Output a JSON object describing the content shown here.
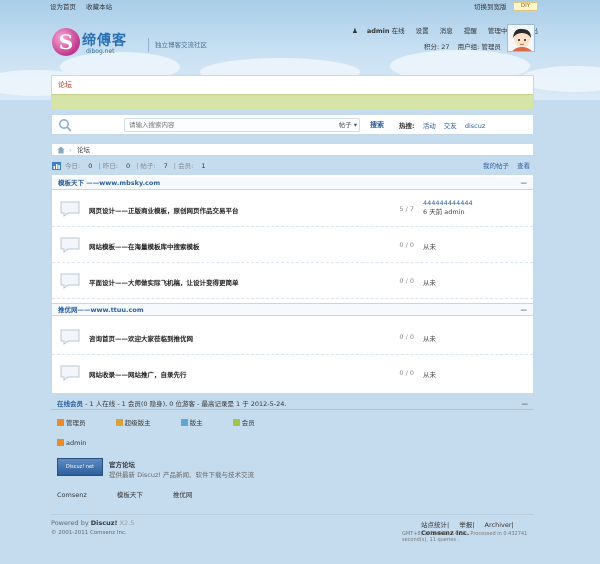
{
  "topbar": {
    "set_home": "设为首页",
    "bookmark": "收藏本站",
    "switch_style": "切换到宽版",
    "diy": "DIY"
  },
  "logo": {
    "letter": "S",
    "name": "缔傅客",
    "domain": "dibog.net"
  },
  "slogan": "独立博客交流社区",
  "user": {
    "name": "admin",
    "status": "在线",
    "links": [
      "设置",
      "消息",
      "提醒",
      "管理中心",
      "退出"
    ],
    "points_label": "积分: 27",
    "group_label": "用户组: 管理员"
  },
  "nav": {
    "active_tab": "论坛"
  },
  "search": {
    "placeholder": "请输入搜索内容",
    "scope": "帖子",
    "button": "搜索",
    "hot_label": "热搜:",
    "hot_items": [
      "活动",
      "交友",
      "discuz"
    ]
  },
  "breadcrumb": {
    "sep": "›",
    "current": "论坛"
  },
  "stats": {
    "today_label": "今日:",
    "today": "0",
    "yesterday_label": "昨日:",
    "yesterday": "0",
    "posts_label": "帖子:",
    "posts": "7",
    "members_label": "会员:",
    "members": "1",
    "my_posts": "我的帖子",
    "new_posts": "查看新帖"
  },
  "categories": [
    {
      "title": "模板天下 ——www.mbsky.com",
      "forums": [
        {
          "name": "网页设计——正版商业模板，原创网页作品交易平台",
          "count": "5 / 7",
          "last_title": "444444444444",
          "last_meta": "6 天前  admin"
        },
        {
          "name": "网站模板——在海量模板库中搜索模板",
          "count": "0 / 0",
          "last": "从未"
        },
        {
          "name": "平面设计——大师做实际飞机稿，让设计变得更简单",
          "count": "0 / 0",
          "last": "从未"
        }
      ]
    },
    {
      "title": "推优网——www.ttuu.com",
      "forums": [
        {
          "name": "咨询首页——欢迎大家莅临到推优网",
          "count": "0 / 0",
          "last": "从未"
        },
        {
          "name": "网站收录——网站推广，自录先行",
          "count": "0 / 0",
          "last": "从未"
        }
      ]
    }
  ],
  "online": {
    "title": "在线会员",
    "summary": " - 1 人在线 - 1 会员(0 隐身), 0 位游客 - 最高记录是 1 于 2012-5-24.",
    "legend": [
      {
        "label": "管理员",
        "color": "#e98b2a"
      },
      {
        "label": "超级版主",
        "color": "#d9a23a"
      },
      {
        "label": "版主",
        "color": "#5fa6d8"
      },
      {
        "label": "会员",
        "color": "#a5c24a"
      }
    ],
    "admin_user": "admin"
  },
  "official": {
    "badge": "Discuz! net",
    "title": "官方论坛",
    "desc": "提供最新 Discuz! 产品新闻、软件下载与技术交流"
  },
  "friend_links": [
    "Comsenz",
    "模板天下",
    "推优网"
  ],
  "footer": {
    "powered_prefix": "Powered by ",
    "product": "Discuz!",
    "version": " X2.5",
    "copyright": "© 2001-2011 Comsenz Inc.",
    "links": [
      "站点统计",
      "举报",
      "Archiver"
    ],
    "company": "Comsenz Inc.",
    "gmt": "GMT+8, 2012-5-30 14:58 , Processed in 0.432741 second(s), 11 queries ."
  }
}
